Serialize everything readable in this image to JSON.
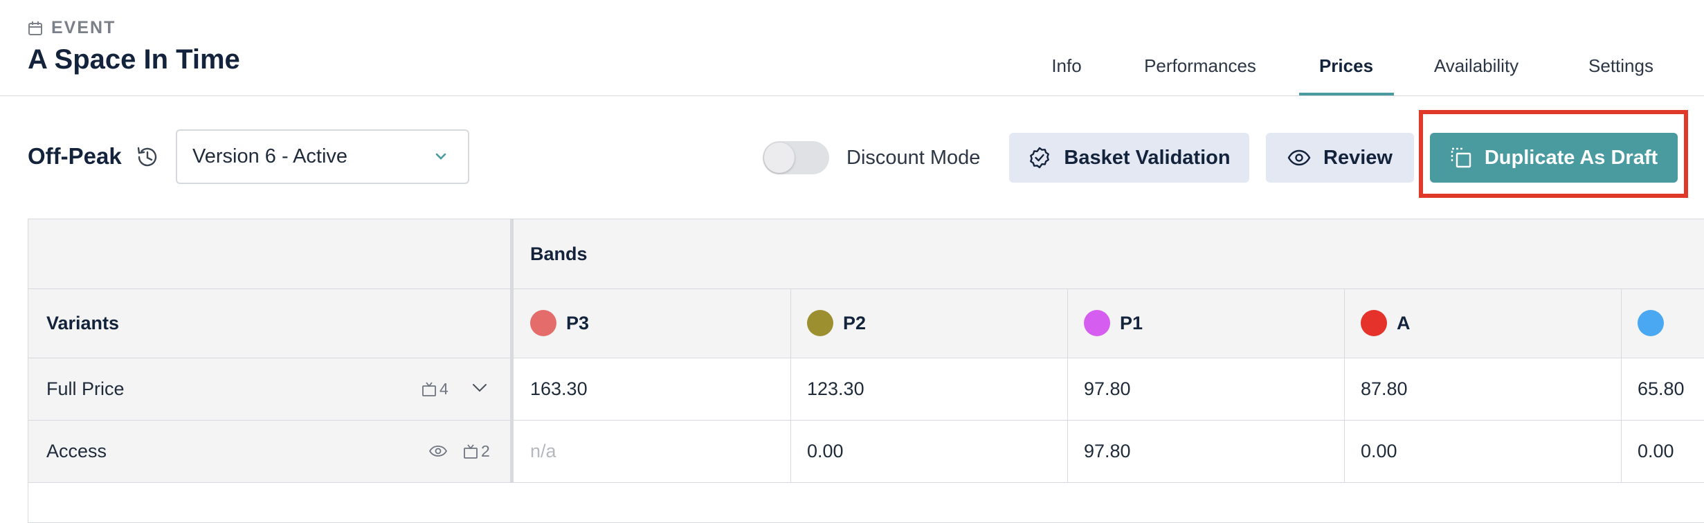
{
  "header": {
    "section_label": "EVENT",
    "title": "A Space In Time",
    "tabs": [
      {
        "label": "Info",
        "active": false
      },
      {
        "label": "Performances",
        "active": false
      },
      {
        "label": "Prices",
        "active": true
      },
      {
        "label": "Availability",
        "active": false
      },
      {
        "label": "Settings",
        "active": false
      }
    ]
  },
  "toolbar": {
    "mode_label": "Off-Peak",
    "version_value": "Version 6 - Active",
    "discount_mode_label": "Discount Mode",
    "discount_mode_on": false,
    "basket_validation_label": "Basket Validation",
    "review_label": "Review",
    "duplicate_label": "Duplicate As Draft"
  },
  "table": {
    "bands_header": "Bands",
    "variants_header": "Variants",
    "bands": [
      {
        "name": "P3",
        "color": "#e46d6b"
      },
      {
        "name": "P2",
        "color": "#9c8f2f"
      },
      {
        "name": "P1",
        "color": "#d55ef0"
      },
      {
        "name": "A",
        "color": "#e5322b"
      },
      {
        "name": "",
        "color": "#4aa8f2"
      }
    ],
    "rows": [
      {
        "variant": "Full Price",
        "count": "4",
        "has_eye": false,
        "values": [
          "163.30",
          "123.30",
          "97.80",
          "87.80",
          "65.80"
        ]
      },
      {
        "variant": "Access",
        "count": "2",
        "has_eye": true,
        "values": [
          "n/a",
          "0.00",
          "97.80",
          "0.00",
          "0.00"
        ]
      }
    ]
  },
  "colors": {
    "accent": "#4a9b9f",
    "highlight": "#e0392a",
    "light_button": "#e4e8f3",
    "title": "#14233c"
  }
}
